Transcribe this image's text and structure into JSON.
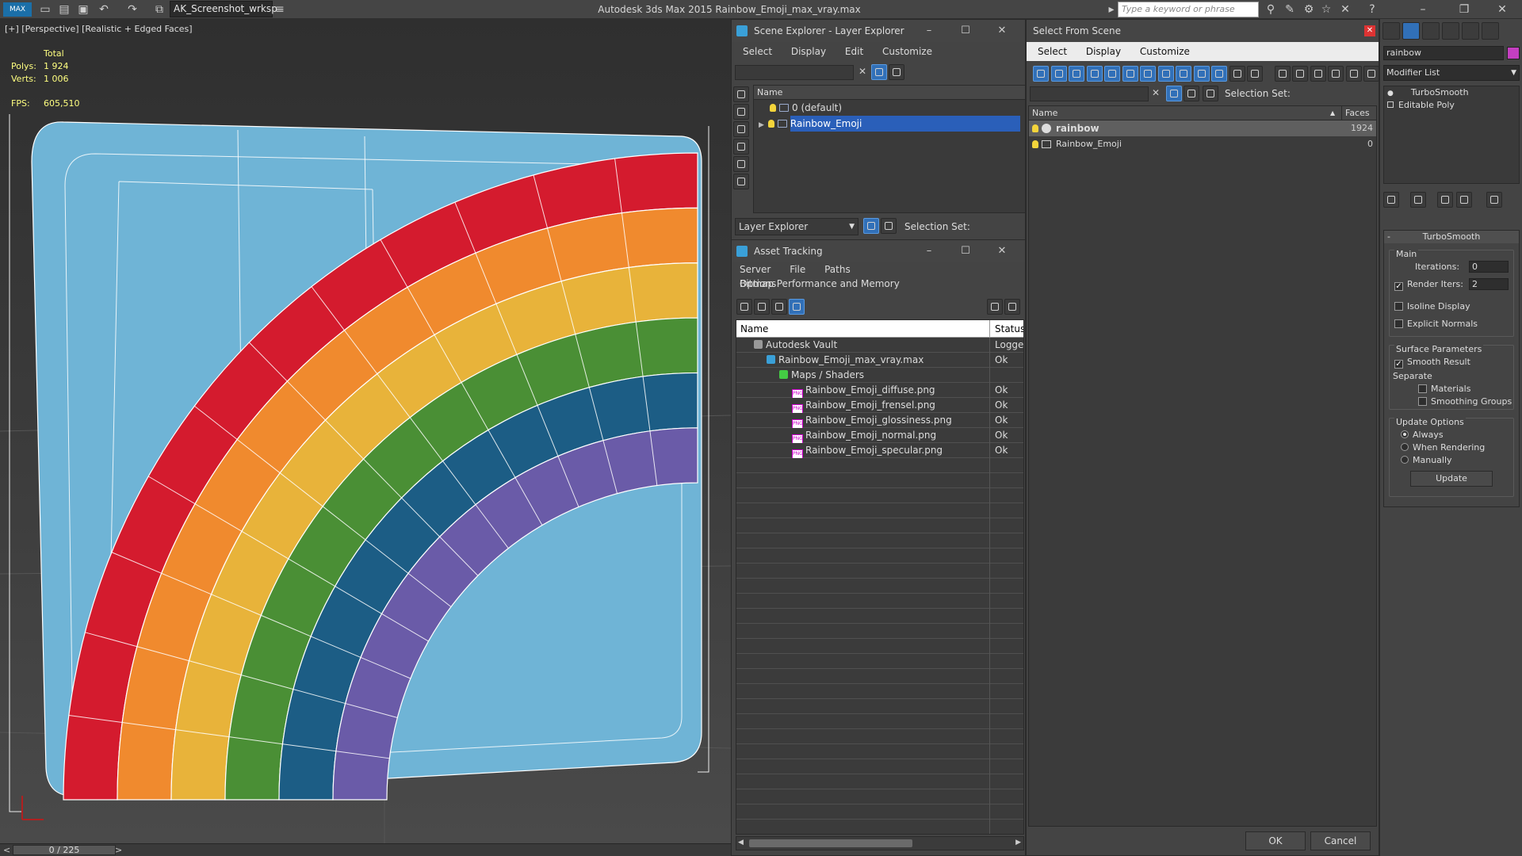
{
  "titlebar": {
    "workspace": "AK_Screenshot_wrksp",
    "app_title": "Autodesk 3ds Max  2015     Rainbow_Emoji_max_vray.max",
    "search_placeholder": "Type a keyword or phrase"
  },
  "viewport": {
    "label": "[+] [Perspective] [Realistic + Edged Faces]",
    "stats_header": "Total",
    "polys_label": "Polys:",
    "polys_value": "1 924",
    "verts_label": "Verts:",
    "verts_value": "1 006",
    "fps_label": "FPS:",
    "fps_value": "605,510",
    "colors": {
      "background": "#6fb4d6",
      "red": "#d41b2e",
      "orange": "#f08a2e",
      "yellow": "#e8b33a",
      "green": "#4a8f35",
      "blue": "#1c5d85",
      "purple": "#6a5ba8"
    }
  },
  "timebar": {
    "frame": "0 / 225",
    "prev": "<",
    "next": ">"
  },
  "scene_explorer": {
    "title": "Scene Explorer - Layer Explorer",
    "menu": [
      "Select",
      "Display",
      "Edit",
      "Customize"
    ],
    "column_name": "Name",
    "rows": [
      "0 (default)",
      "Rainbow_Emoji"
    ],
    "bottom_dropdown": "Layer Explorer",
    "selection_set_label": "Selection Set:"
  },
  "asset_tracking": {
    "title": "Asset Tracking",
    "menu": [
      "Server",
      "File",
      "Paths",
      "Bitmap Performance and Memory",
      "Options"
    ],
    "col_name": "Name",
    "col_status": "Status",
    "rows": [
      {
        "name": "Autodesk Vault",
        "status": "Logged"
      },
      {
        "name": "Rainbow_Emoji_max_vray.max",
        "status": "Ok"
      },
      {
        "name": "Maps / Shaders",
        "status": ""
      },
      {
        "name": "Rainbow_Emoji_diffuse.png",
        "status": "Ok"
      },
      {
        "name": "Rainbow_Emoji_frensel.png",
        "status": "Ok"
      },
      {
        "name": "Rainbow_Emoji_glossiness.png",
        "status": "Ok"
      },
      {
        "name": "Rainbow_Emoji_normal.png",
        "status": "Ok"
      },
      {
        "name": "Rainbow_Emoji_specular.png",
        "status": "Ok"
      }
    ]
  },
  "select_from_scene": {
    "title": "Select From Scene",
    "menu": [
      "Select",
      "Display",
      "Customize"
    ],
    "selection_set_label": "Selection Set:",
    "col_name": "Name",
    "col_faces": "Faces",
    "rows": [
      {
        "name": "rainbow",
        "faces": "1924"
      },
      {
        "name": "Rainbow_Emoji",
        "faces": "0"
      }
    ],
    "ok": "OK",
    "cancel": "Cancel"
  },
  "command_panel": {
    "object_name": "rainbow",
    "modifier_list": "Modifier List",
    "stack": [
      "TurboSmooth",
      "Editable Poly"
    ],
    "rollout_title": "TurboSmooth",
    "main_group": "Main",
    "iterations_label": "Iterations:",
    "iterations_value": "0",
    "render_iters_label": "Render Iters:",
    "render_iters_value": "2",
    "isoline": "Isoline Display",
    "explicit_normals": "Explicit Normals",
    "surface_group": "Surface Parameters",
    "smooth_result": "Smooth Result",
    "separate_label": "Separate",
    "materials": "Materials",
    "smoothing_groups": "Smoothing Groups",
    "update_group": "Update Options",
    "always": "Always",
    "when_rendering": "When Rendering",
    "manually": "Manually",
    "update_button": "Update"
  }
}
